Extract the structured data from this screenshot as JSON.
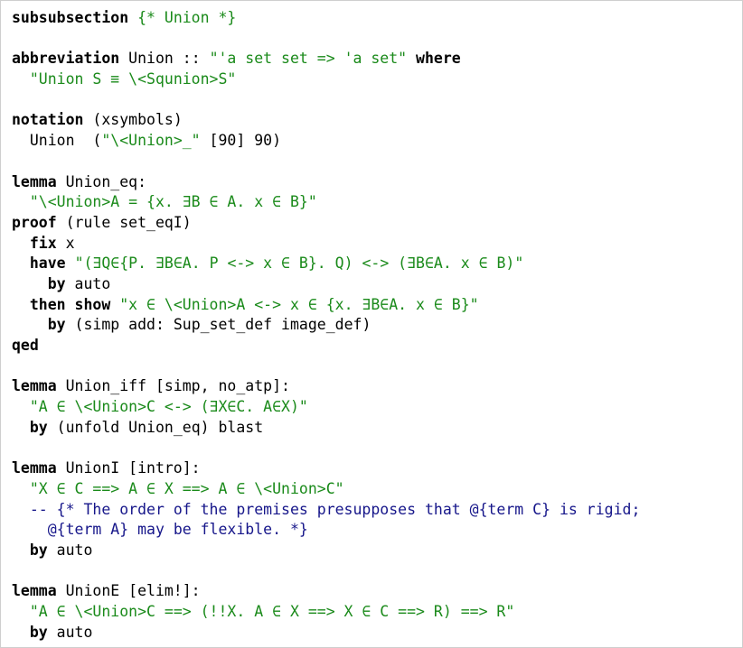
{
  "theory_text": {
    "lines": [
      [
        {
          "t": "subsubsection",
          "c": "kw"
        },
        {
          "t": " ",
          "c": "plain"
        },
        {
          "t": "{* Union *}",
          "c": "str"
        }
      ],
      [],
      [
        {
          "t": "abbreviation",
          "c": "kw"
        },
        {
          "t": " Union :: ",
          "c": "plain"
        },
        {
          "t": "\"'a set set => 'a set\"",
          "c": "str"
        },
        {
          "t": " ",
          "c": "plain"
        },
        {
          "t": "where",
          "c": "kw"
        }
      ],
      [
        {
          "t": "  ",
          "c": "plain"
        },
        {
          "t": "\"Union S ≡ \\<Squnion>S\"",
          "c": "str"
        }
      ],
      [],
      [
        {
          "t": "notation",
          "c": "kw"
        },
        {
          "t": " (xsymbols)",
          "c": "plain"
        }
      ],
      [
        {
          "t": "  Union  (",
          "c": "plain"
        },
        {
          "t": "\"\\<Union>_\"",
          "c": "str"
        },
        {
          "t": " [90] 90)",
          "c": "plain"
        }
      ],
      [],
      [
        {
          "t": "lemma",
          "c": "kw"
        },
        {
          "t": " Union_eq:",
          "c": "plain"
        }
      ],
      [
        {
          "t": "  ",
          "c": "plain"
        },
        {
          "t": "\"\\<Union>A = {x. ∃B ∈ A. x ∈ B}\"",
          "c": "str"
        }
      ],
      [
        {
          "t": "proof",
          "c": "kw"
        },
        {
          "t": " (rule set_eqI)",
          "c": "plain"
        }
      ],
      [
        {
          "t": "  ",
          "c": "plain"
        },
        {
          "t": "fix",
          "c": "kw"
        },
        {
          "t": " x",
          "c": "plain"
        }
      ],
      [
        {
          "t": "  ",
          "c": "plain"
        },
        {
          "t": "have",
          "c": "kw"
        },
        {
          "t": " ",
          "c": "plain"
        },
        {
          "t": "\"(∃Q∈{P. ∃B∈A. P <-> x ∈ B}. Q) <-> (∃B∈A. x ∈ B)\"",
          "c": "str"
        }
      ],
      [
        {
          "t": "    ",
          "c": "plain"
        },
        {
          "t": "by",
          "c": "kw"
        },
        {
          "t": " auto",
          "c": "plain"
        }
      ],
      [
        {
          "t": "  ",
          "c": "plain"
        },
        {
          "t": "then show",
          "c": "kw"
        },
        {
          "t": " ",
          "c": "plain"
        },
        {
          "t": "\"x ∈ \\<Union>A <-> x ∈ {x. ∃B∈A. x ∈ B}\"",
          "c": "str"
        }
      ],
      [
        {
          "t": "    ",
          "c": "plain"
        },
        {
          "t": "by",
          "c": "kw"
        },
        {
          "t": " (simp add: Sup_set_def image_def)",
          "c": "plain"
        }
      ],
      [
        {
          "t": "qed",
          "c": "kw"
        }
      ],
      [],
      [
        {
          "t": "lemma",
          "c": "kw"
        },
        {
          "t": " Union_iff [simp, no_atp]:",
          "c": "plain"
        }
      ],
      [
        {
          "t": "  ",
          "c": "plain"
        },
        {
          "t": "\"A ∈ \\<Union>C <-> (∃X∈C. A∈X)\"",
          "c": "str"
        }
      ],
      [
        {
          "t": "  ",
          "c": "plain"
        },
        {
          "t": "by",
          "c": "kw"
        },
        {
          "t": " (unfold Union_eq) blast",
          "c": "plain"
        }
      ],
      [],
      [
        {
          "t": "lemma",
          "c": "kw"
        },
        {
          "t": " UnionI [intro]:",
          "c": "plain"
        }
      ],
      [
        {
          "t": "  ",
          "c": "plain"
        },
        {
          "t": "\"X ∈ C ==> A ∈ X ==> A ∈ \\<Union>C\"",
          "c": "str"
        }
      ],
      [
        {
          "t": "  ",
          "c": "plain"
        },
        {
          "t": "-- {* The order of the premises presupposes that @{term C} is rigid;",
          "c": "cmt"
        }
      ],
      [
        {
          "t": "    ",
          "c": "plain"
        },
        {
          "t": "@{term A} may be flexible. *}",
          "c": "cmt"
        }
      ],
      [
        {
          "t": "  ",
          "c": "plain"
        },
        {
          "t": "by",
          "c": "kw"
        },
        {
          "t": " auto",
          "c": "plain"
        }
      ],
      [],
      [
        {
          "t": "lemma",
          "c": "kw"
        },
        {
          "t": " UnionE [elim!]:",
          "c": "plain"
        }
      ],
      [
        {
          "t": "  ",
          "c": "plain"
        },
        {
          "t": "\"A ∈ \\<Union>C ==> (!!X. A ∈ X ==> X ∈ C ==> R) ==> R\"",
          "c": "str"
        }
      ],
      [
        {
          "t": "  ",
          "c": "plain"
        },
        {
          "t": "by",
          "c": "kw"
        },
        {
          "t": " auto",
          "c": "plain"
        }
      ]
    ]
  }
}
